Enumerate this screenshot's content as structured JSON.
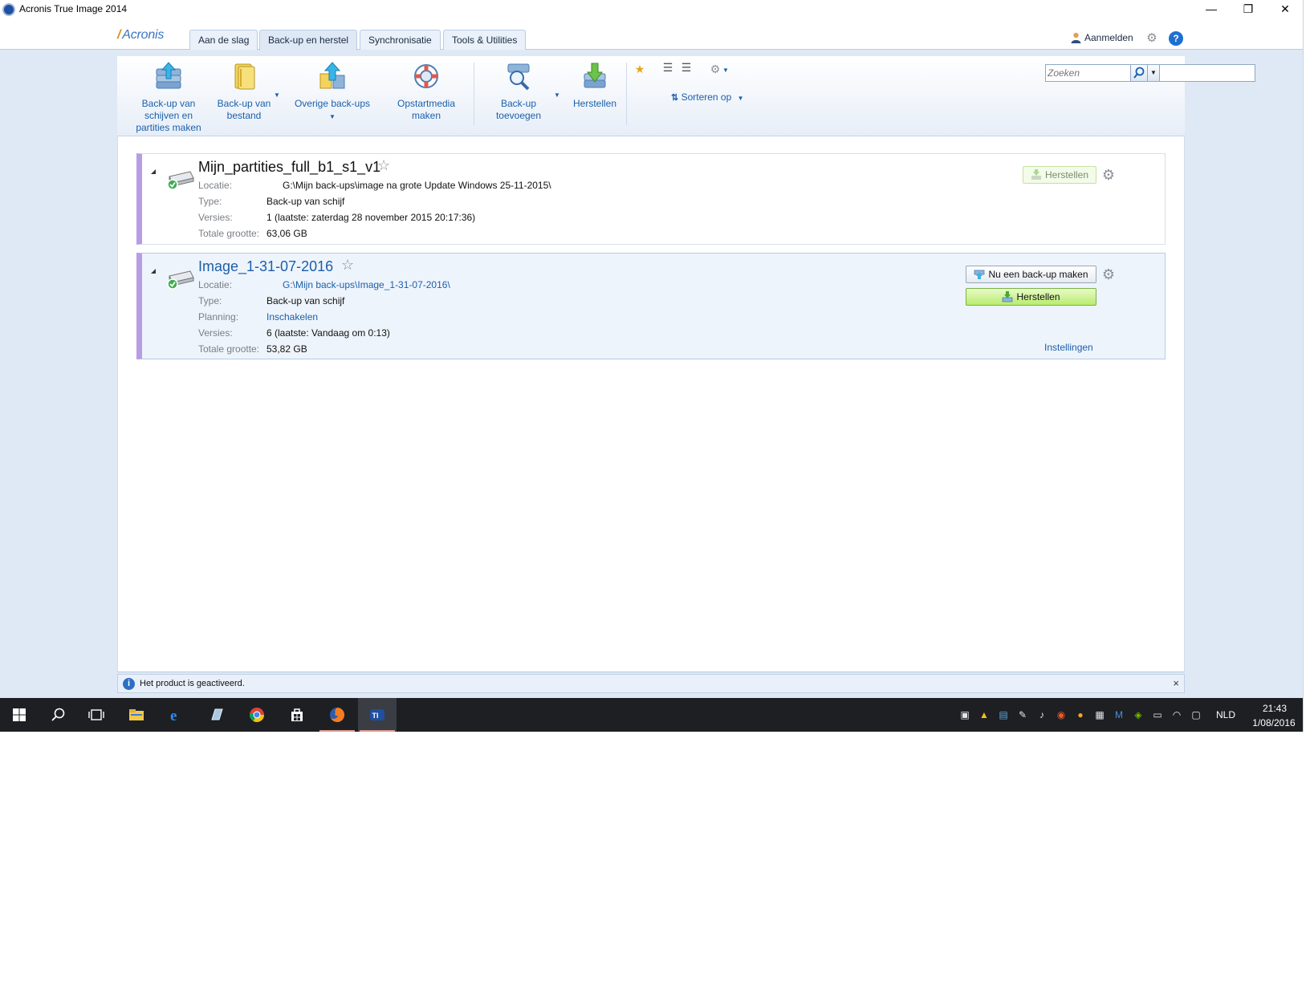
{
  "window": {
    "title": "Acronis True Image 2014",
    "min_glyph": "—",
    "restore_glyph": "❐",
    "close_glyph": "✕"
  },
  "header": {
    "logo_text": "Acronis",
    "tabs": [
      {
        "label": "Aan de slag",
        "active": false
      },
      {
        "label": "Back-up en herstel",
        "active": true
      },
      {
        "label": "Synchronisatie",
        "active": false
      },
      {
        "label": "Tools & Utilities",
        "active": false
      }
    ],
    "signin_label": "Aanmelden",
    "settings_icon": "gear-icon",
    "help_icon": "help-icon",
    "help_glyph": "?"
  },
  "toolbar": {
    "disk_backup_label_1": "Back-up van",
    "disk_backup_label_2": "schijven en",
    "disk_backup_label_3": "partities maken",
    "file_backup_label_1": "Back-up van",
    "file_backup_label_2": "bestand",
    "other_backups_label": "Overige back-ups",
    "bootmedia_label_1": "Opstartmedia",
    "bootmedia_label_2": "maken",
    "add_backup_label_1": "Back-up",
    "add_backup_label_2": "toevoegen",
    "restore_label": "Herstellen",
    "sort_label": "Sorteren op",
    "search_placeholder": "Zoeken",
    "search_value": ""
  },
  "backups": [
    {
      "title": "Mijn_partities_full_b1_s1_v1",
      "rows": [
        {
          "label": "Locatie:",
          "value": "G:\\Mijn back-ups\\image na grote Update Windows 25-11-2015\\"
        },
        {
          "label": "Type:",
          "value": "Back-up van schijf"
        },
        {
          "label": "Versies:",
          "value": "1 (laatste: zaterdag 28 november 2015 20:17:36)"
        },
        {
          "label": "Totale grootte:",
          "value": "63,06 GB"
        }
      ],
      "restore_label": "Herstellen"
    },
    {
      "title": "Image_1-31-07-2016",
      "rows": [
        {
          "label": "Locatie:",
          "value": "G:\\Mijn back-ups\\Image_1-31-07-2016\\"
        },
        {
          "label": "Type:",
          "value": "Back-up van schijf"
        },
        {
          "label": "Planning:",
          "value": "Inschakelen"
        },
        {
          "label": "Versies:",
          "value": "6 (laatste: Vandaag om 0:13)"
        },
        {
          "label": "Totale grootte:",
          "value": "53,82 GB"
        }
      ],
      "backup_now_label": "Nu een back-up maken",
      "restore_label": "Herstellen",
      "settings_link": "Instellingen"
    }
  ],
  "statusbar": {
    "info_glyph": "i",
    "text": "Het product is geactiveerd.",
    "close_glyph": "×"
  },
  "taskbar": {
    "language": "NLD",
    "time": "21:43",
    "date": "1/08/2016"
  },
  "colors": {
    "accent": "#1b5faa",
    "card_stripe": "#b79de4",
    "green_button": "#b8ec6e",
    "taskbar": "#1d1f23"
  }
}
